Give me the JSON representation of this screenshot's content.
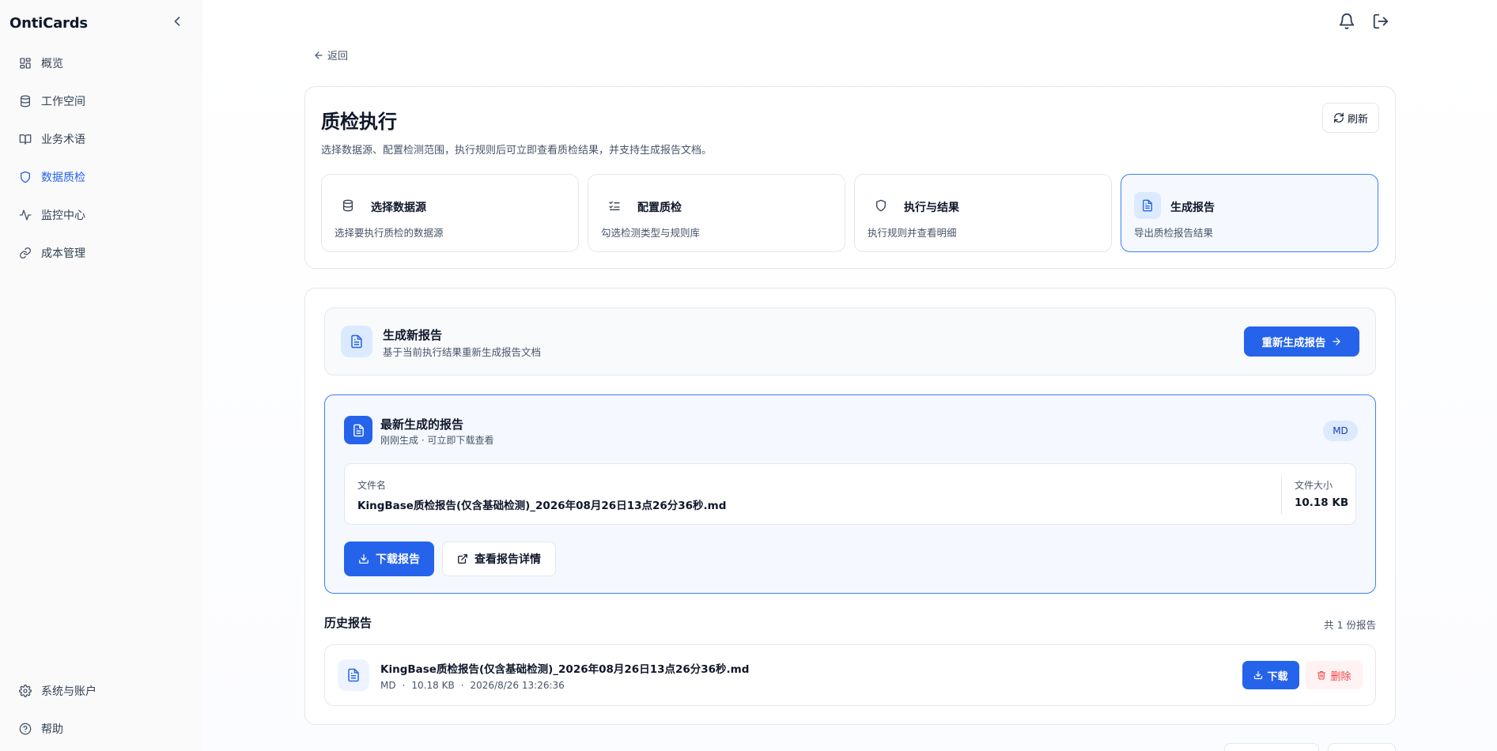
{
  "app": {
    "brand": "OntiCards"
  },
  "sidebar": {
    "items": [
      {
        "label": "概览",
        "icon": "grid-icon"
      },
      {
        "label": "工作空间",
        "icon": "database-icon"
      },
      {
        "label": "业务术语",
        "icon": "book-icon"
      },
      {
        "label": "数据质检",
        "icon": "shield-icon",
        "active": true
      },
      {
        "label": "监控中心",
        "icon": "activity-icon"
      },
      {
        "label": "成本管理",
        "icon": "link-icon"
      }
    ],
    "bottom": [
      {
        "label": "系统与账户",
        "icon": "gear-icon"
      },
      {
        "label": "帮助",
        "icon": "help-icon"
      }
    ]
  },
  "header": {
    "back_label": "返回"
  },
  "page": {
    "title": "质检执行",
    "description": "选择数据源、配置检测范围，执行规则后可立即查看质检结果，并支持生成报告文档。",
    "refresh_label": "刷新"
  },
  "steps": [
    {
      "title": "选择数据源",
      "desc": "选择要执行质检的数据源",
      "icon": "database-icon"
    },
    {
      "title": "配置质检",
      "desc": "勾选检测类型与规则库",
      "icon": "list-check-icon"
    },
    {
      "title": "执行与结果",
      "desc": "执行规则并查看明细",
      "icon": "shield-icon"
    },
    {
      "title": "生成报告",
      "desc": "导出质检报告结果",
      "icon": "file-text-icon",
      "active": true
    }
  ],
  "generate": {
    "title": "生成新报告",
    "desc": "基于当前执行结果重新生成报告文档",
    "button": "重新生成报告"
  },
  "latest": {
    "title": "最新生成的报告",
    "subtitle": "刚刚生成 · 可立即下载查看",
    "badge": "MD",
    "filename_label": "文件名",
    "filename": "KingBase质检报告(仅含基础检测)_2026年08月26日13点26分36秒.md",
    "filesize_label": "文件大小",
    "filesize": "10.18 KB",
    "download_label": "下载报告",
    "view_label": "查看报告详情"
  },
  "history": {
    "title": "历史报告",
    "count": "共 1 份报告",
    "rows": [
      {
        "name": "KingBase质检报告(仅含基础检测)_2026年08月26日13点26分36秒.md",
        "format": "MD",
        "size": "10.18 KB",
        "time": "2026/8/26 13:26:36",
        "download_label": "下载",
        "delete_label": "删除"
      }
    ]
  },
  "colors": {
    "accent": "#2563eb",
    "danger": "#ef4444",
    "active_bg": "#f5f8ff"
  }
}
